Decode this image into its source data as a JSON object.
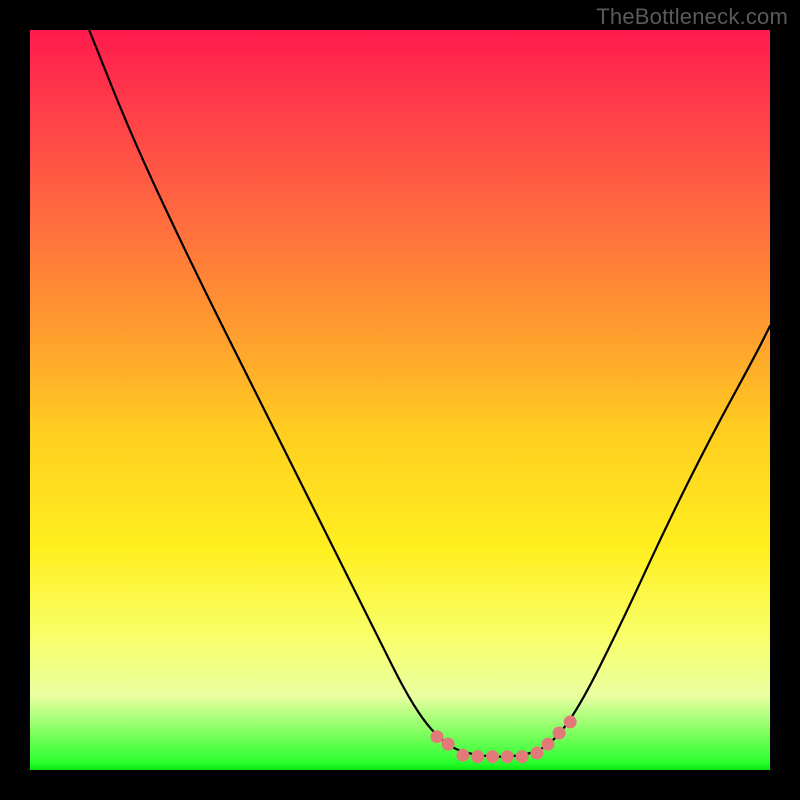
{
  "watermark": "TheBottleneck.com",
  "chart_data": {
    "type": "line",
    "title": "",
    "xlabel": "",
    "ylabel": "",
    "xlim": [
      0,
      100
    ],
    "ylim": [
      0,
      100
    ],
    "grid": false,
    "legend": false,
    "background_gradient": {
      "direction": "vertical",
      "stops": [
        {
          "pos": 0.0,
          "color": "#ff1a4d"
        },
        {
          "pos": 0.1,
          "color": "#ff3b4a"
        },
        {
          "pos": 0.25,
          "color": "#ff6a3f"
        },
        {
          "pos": 0.4,
          "color": "#ff9a2f"
        },
        {
          "pos": 0.55,
          "color": "#ffd01f"
        },
        {
          "pos": 0.7,
          "color": "#ffef1f"
        },
        {
          "pos": 0.82,
          "color": "#f9ff6a"
        },
        {
          "pos": 0.9,
          "color": "#e9ffa0"
        },
        {
          "pos": 0.99,
          "color": "#2aff2e"
        },
        {
          "pos": 1.0,
          "color": "#08e80f"
        }
      ]
    },
    "series": [
      {
        "name": "curve",
        "color": "#000000",
        "points": [
          {
            "x": 8.0,
            "y": 100.0
          },
          {
            "x": 14.0,
            "y": 85.0
          },
          {
            "x": 22.0,
            "y": 68.0
          },
          {
            "x": 30.0,
            "y": 52.0
          },
          {
            "x": 38.0,
            "y": 36.0
          },
          {
            "x": 46.0,
            "y": 20.0
          },
          {
            "x": 52.0,
            "y": 8.0
          },
          {
            "x": 56.5,
            "y": 3.0
          },
          {
            "x": 61.0,
            "y": 1.8
          },
          {
            "x": 66.0,
            "y": 1.8
          },
          {
            "x": 70.0,
            "y": 3.0
          },
          {
            "x": 74.0,
            "y": 8.0
          },
          {
            "x": 80.0,
            "y": 20.0
          },
          {
            "x": 86.0,
            "y": 33.0
          },
          {
            "x": 92.0,
            "y": 45.0
          },
          {
            "x": 98.0,
            "y": 56.0
          },
          {
            "x": 100.0,
            "y": 60.0
          }
        ]
      },
      {
        "name": "pink-dots",
        "color": "#e37a7a",
        "points": [
          {
            "x": 55.0,
            "y": 4.5
          },
          {
            "x": 56.5,
            "y": 3.5
          },
          {
            "x": 58.5,
            "y": 2.0
          },
          {
            "x": 60.5,
            "y": 1.8
          },
          {
            "x": 62.5,
            "y": 1.8
          },
          {
            "x": 64.5,
            "y": 1.8
          },
          {
            "x": 66.5,
            "y": 1.8
          },
          {
            "x": 68.5,
            "y": 2.3
          },
          {
            "x": 70.0,
            "y": 3.5
          },
          {
            "x": 71.5,
            "y": 5.0
          },
          {
            "x": 73.0,
            "y": 6.5
          }
        ]
      }
    ]
  }
}
